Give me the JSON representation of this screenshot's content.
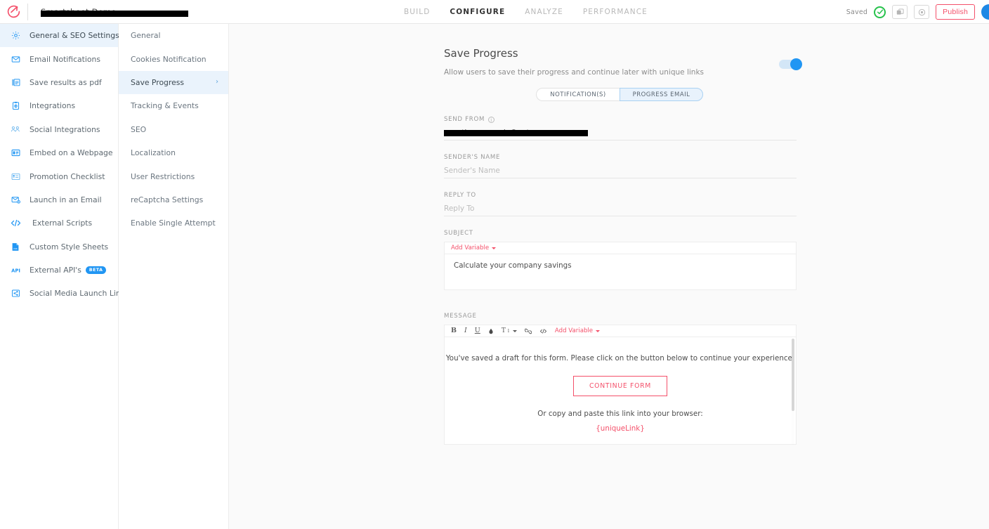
{
  "topbar": {
    "form_title": "Smartsheet Demo",
    "nav": [
      {
        "label": "BUILD",
        "active": false
      },
      {
        "label": "CONFIGURE",
        "active": true
      },
      {
        "label": "ANALYZE",
        "active": false
      },
      {
        "label": "PERFORMANCE",
        "active": false
      }
    ],
    "saved_label": "Saved",
    "publish_label": "Publish",
    "accent_red": "#f4506a",
    "accent_blue": "#2196f3",
    "success_green": "#27c24c"
  },
  "sidebar": {
    "items": [
      {
        "label": "General & SEO Settings",
        "icon": "gear-icon",
        "active": true
      },
      {
        "label": "Email Notifications",
        "icon": "envelope-icon",
        "active": false
      },
      {
        "label": "Save results as pdf",
        "icon": "pdf-icon",
        "active": false
      },
      {
        "label": "Integrations",
        "icon": "integrations-icon",
        "active": false
      },
      {
        "label": "Social Integrations",
        "icon": "people-icon",
        "active": false
      },
      {
        "label": "Embed on a Webpage",
        "icon": "embed-icon",
        "active": false
      },
      {
        "label": "Promotion Checklist",
        "icon": "checklist-icon",
        "active": false
      },
      {
        "label": "Launch in an Email",
        "icon": "email-launch-icon",
        "active": false
      },
      {
        "label": "External Scripts",
        "icon": "code-icon",
        "active": false
      },
      {
        "label": "Custom Style Sheets",
        "icon": "css-file-icon",
        "active": false
      },
      {
        "label": "External API's",
        "icon": "api-icon",
        "active": false,
        "badge": "BETA"
      },
      {
        "label": "Social Media Launch Links",
        "icon": "share-icon",
        "active": false
      }
    ]
  },
  "subnav": {
    "items": [
      {
        "label": "General",
        "active": false
      },
      {
        "label": "Cookies Notification",
        "active": false
      },
      {
        "label": "Save Progress",
        "active": true
      },
      {
        "label": "Tracking & Events",
        "active": false
      },
      {
        "label": "SEO",
        "active": false
      },
      {
        "label": "Localization",
        "active": false
      },
      {
        "label": "User Restrictions",
        "active": false
      },
      {
        "label": "reCaptcha Settings",
        "active": false
      },
      {
        "label": "Enable Single Attempt",
        "active": false
      }
    ]
  },
  "main": {
    "title": "Save Progress",
    "subtitle": "Allow users to save their progress and continue later with unique links",
    "toggle_on": true,
    "tabs": [
      {
        "label": "NOTIFICATION(S)",
        "active": false
      },
      {
        "label": "PROGRESS EMAIL",
        "active": true
      }
    ],
    "send_from": {
      "label": "SEND FROM",
      "value": "questions-noreply@outgrow.co"
    },
    "sender_name": {
      "label": "SENDER'S NAME",
      "placeholder": "Sender's Name",
      "value": ""
    },
    "reply_to": {
      "label": "REPLY TO",
      "placeholder": "Reply To",
      "value": ""
    },
    "subject": {
      "label": "SUBJECT",
      "add_variable": "Add Variable",
      "value": "Calculate your company savings"
    },
    "message": {
      "label": "MESSAGE",
      "add_variable": "Add Variable",
      "line1": "You've saved a draft for this form. Please click on the button below to continue your experience.",
      "button_label": "CONTINUE FORM",
      "line2": "Or copy and paste this link into your browser:",
      "link": "{uniqueLink}"
    }
  }
}
